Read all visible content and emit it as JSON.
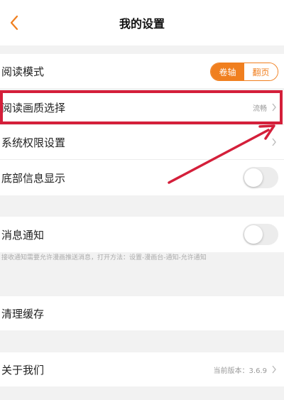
{
  "header": {
    "title": "我的设置",
    "back_icon": "chevron-left-icon"
  },
  "settings": {
    "reading_mode": {
      "label": "阅读模式",
      "options": [
        "卷轴",
        "翻页"
      ],
      "selected": "卷轴"
    },
    "image_quality": {
      "label": "阅读画质选择",
      "value": "流畅"
    },
    "permissions": {
      "label": "系统权限设置"
    },
    "bottom_info": {
      "label": "底部信息显示",
      "enabled": false
    },
    "notifications": {
      "label": "消息通知",
      "enabled": false,
      "hint": "接收通知需要允许漫画推送消息，打开方法：设置-漫画台-通知-允许通知"
    },
    "clear_cache": {
      "label": "清理缓存"
    },
    "about": {
      "label": "关于我们",
      "version_text": "当前版本：3.6.9"
    }
  },
  "colors": {
    "accent": "#f07f1f",
    "highlight": "#d41f3a",
    "background": "#f2f2f2"
  }
}
